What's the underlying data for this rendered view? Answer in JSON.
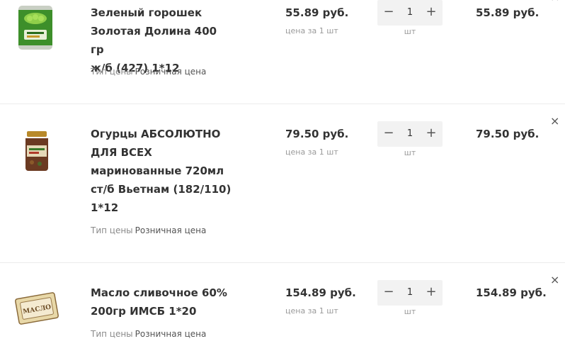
{
  "cart": {
    "items": [
      {
        "name_lines": [
          "Зеленый горошек",
          "Золотая Долина 400 гр",
          "ж/б (427) 1*12"
        ],
        "price_type_label": "Тип цены",
        "price_type_value": "Розничная цена",
        "price": "55.89 руб.",
        "price_unit": "цена за 1 шт",
        "qty": "1",
        "qty_unit": "шт",
        "total": "55.89 руб.",
        "remove": "×"
      },
      {
        "name_lines": [
          "Огурцы АБСОЛЮТНО",
          "ДЛЯ ВСЕХ",
          "маринованные 720мл",
          "ст/б Вьетнам (182/110)",
          "1*12"
        ],
        "price_type_label": "Тип цены",
        "price_type_value": "Розничная цена",
        "price": "79.50 руб.",
        "price_unit": "цена за 1 шт",
        "qty": "1",
        "qty_unit": "шт",
        "total": "79.50 руб.",
        "remove": "×"
      },
      {
        "name_lines": [
          "Масло сливочное 60%",
          "200гр ИМСБ 1*20"
        ],
        "price_type_label": "Тип цены",
        "price_type_value": "Розничная цена",
        "price": "154.89 руб.",
        "price_unit": "цена за 1 шт",
        "qty": "1",
        "qty_unit": "шт",
        "total": "154.89 руб.",
        "remove": "×"
      }
    ],
    "stepper": {
      "minus": "−",
      "plus": "+"
    },
    "image_labels": {
      "butter_pack": "МАСЛО"
    }
  }
}
